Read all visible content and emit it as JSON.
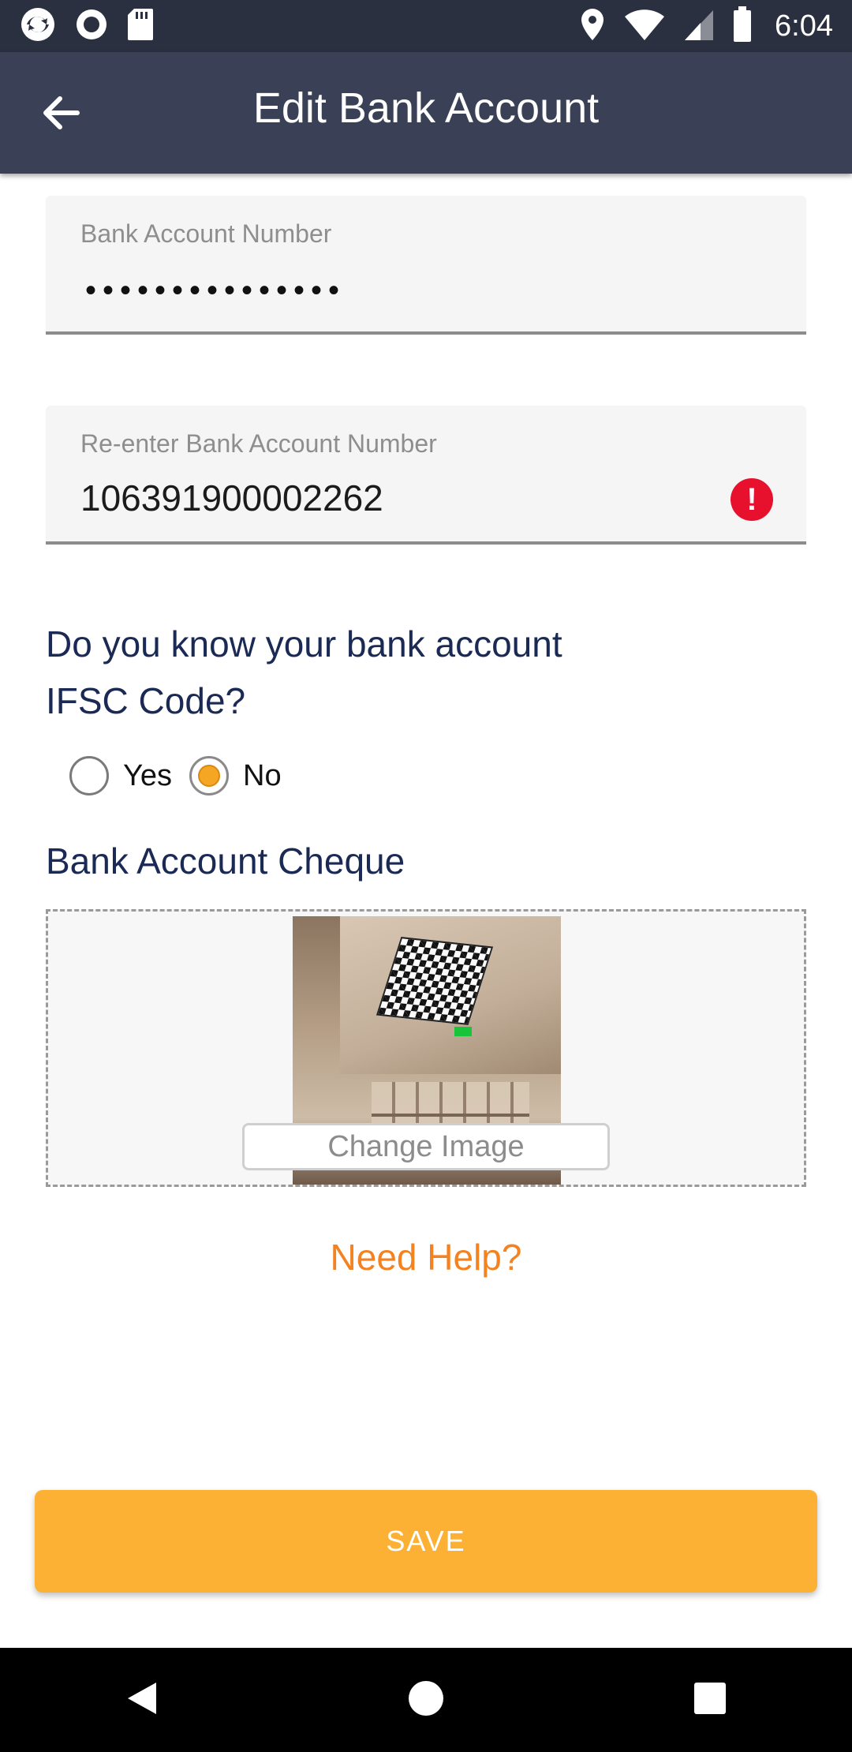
{
  "status_bar": {
    "time": "6:04",
    "left_icons": [
      "sync-icon",
      "record-icon",
      "sd-card-icon"
    ],
    "right_icons": [
      "location-icon",
      "wifi-icon",
      "signal-icon",
      "battery-icon"
    ]
  },
  "app_bar": {
    "title": "Edit Bank Account",
    "back_icon": "arrow-left-icon"
  },
  "form": {
    "account_number": {
      "label": "Bank Account Number",
      "masked_value": "•••••••••••••••"
    },
    "reenter_account_number": {
      "label": "Re-enter Bank Account Number",
      "value": "106391900002262",
      "error_icon": "error-icon"
    },
    "ifsc_question": {
      "line1": "Do you know your bank account",
      "line2": "IFSC Code?"
    },
    "ifsc_radio": {
      "options": [
        "Yes",
        "No"
      ],
      "selected": "No"
    },
    "cheque": {
      "title": "Bank Account Cheque",
      "change_image_label": "Change Image"
    },
    "need_help": "Need Help?",
    "save_label": "SAVE"
  },
  "colors": {
    "app_bar": "#3a4157",
    "heading": "#1a2a55",
    "accent_orange": "#f58220",
    "save_button": "#fdb134",
    "error": "#e8112d"
  }
}
